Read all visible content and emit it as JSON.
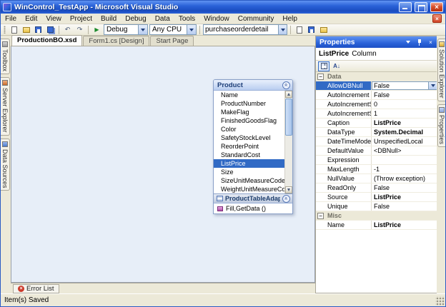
{
  "window": {
    "title": "WinControl_TestApp - Microsoft Visual Studio"
  },
  "menu": {
    "items": [
      "File",
      "Edit",
      "View",
      "Project",
      "Build",
      "Debug",
      "Data",
      "Tools",
      "Window",
      "Community",
      "Help"
    ]
  },
  "toolbar": {
    "config_combo": "Debug",
    "platform_combo": "Any CPU",
    "find_combo": "purchaseorderdetail"
  },
  "doc_tabs": [
    {
      "label": "ProductionBO.xsd",
      "active": true
    },
    {
      "label": "Form1.cs [Design]",
      "active": false
    },
    {
      "label": "Start Page",
      "active": false
    }
  ],
  "left_tabs": [
    {
      "label": "Toolbox"
    },
    {
      "label": "Server Explorer"
    },
    {
      "label": "Data Sources"
    }
  ],
  "right_tabs": [
    {
      "label": "Solution Explorer"
    },
    {
      "label": "Properties"
    }
  ],
  "designer": {
    "table": {
      "title": "Product",
      "columns": [
        {
          "label": "Name"
        },
        {
          "label": "ProductNumber"
        },
        {
          "label": "MakeFlag"
        },
        {
          "label": "FinishedGoodsFlag"
        },
        {
          "label": "Color"
        },
        {
          "label": "SafetyStockLevel"
        },
        {
          "label": "ReorderPoint"
        },
        {
          "label": "StandardCost"
        },
        {
          "label": "ListPrice",
          "selected": true
        },
        {
          "label": "Size"
        },
        {
          "label": "SizeUnitMeasureCode"
        },
        {
          "label": "WeightUnitMeasureCode"
        }
      ]
    },
    "adapter": {
      "title": "ProductTableAdapter",
      "methods": [
        {
          "label": "Fill,GetData ()"
        }
      ]
    }
  },
  "properties": {
    "title": "Properties",
    "object_name": "ListPrice",
    "object_type": "Column",
    "rows": [
      {
        "name": "Data",
        "category": true
      },
      {
        "name": "AllowDBNull",
        "value": "False",
        "selected": true
      },
      {
        "name": "AutoIncrement",
        "value": "False"
      },
      {
        "name": "AutoIncrementSeed",
        "value": "0"
      },
      {
        "name": "AutoIncrementStep",
        "value": "1"
      },
      {
        "name": "Caption",
        "value": "ListPrice",
        "bold": true
      },
      {
        "name": "DataType",
        "value": "System.Decimal",
        "bold": true
      },
      {
        "name": "DateTimeMode",
        "value": "UnspecifiedLocal"
      },
      {
        "name": "DefaultValue",
        "value": "<DBNull>"
      },
      {
        "name": "Expression",
        "value": ""
      },
      {
        "name": "MaxLength",
        "value": "-1"
      },
      {
        "name": "NullValue",
        "value": "(Throw exception)"
      },
      {
        "name": "ReadOnly",
        "value": "False"
      },
      {
        "name": "Source",
        "value": "ListPrice",
        "bold": true
      },
      {
        "name": "Unique",
        "value": "False"
      },
      {
        "name": "Misc",
        "category": true
      },
      {
        "name": "Name",
        "value": "ListPrice",
        "bold": true
      }
    ]
  },
  "error_list": {
    "label": "Error List"
  },
  "status_bar": {
    "text": "Item(s) Saved"
  }
}
